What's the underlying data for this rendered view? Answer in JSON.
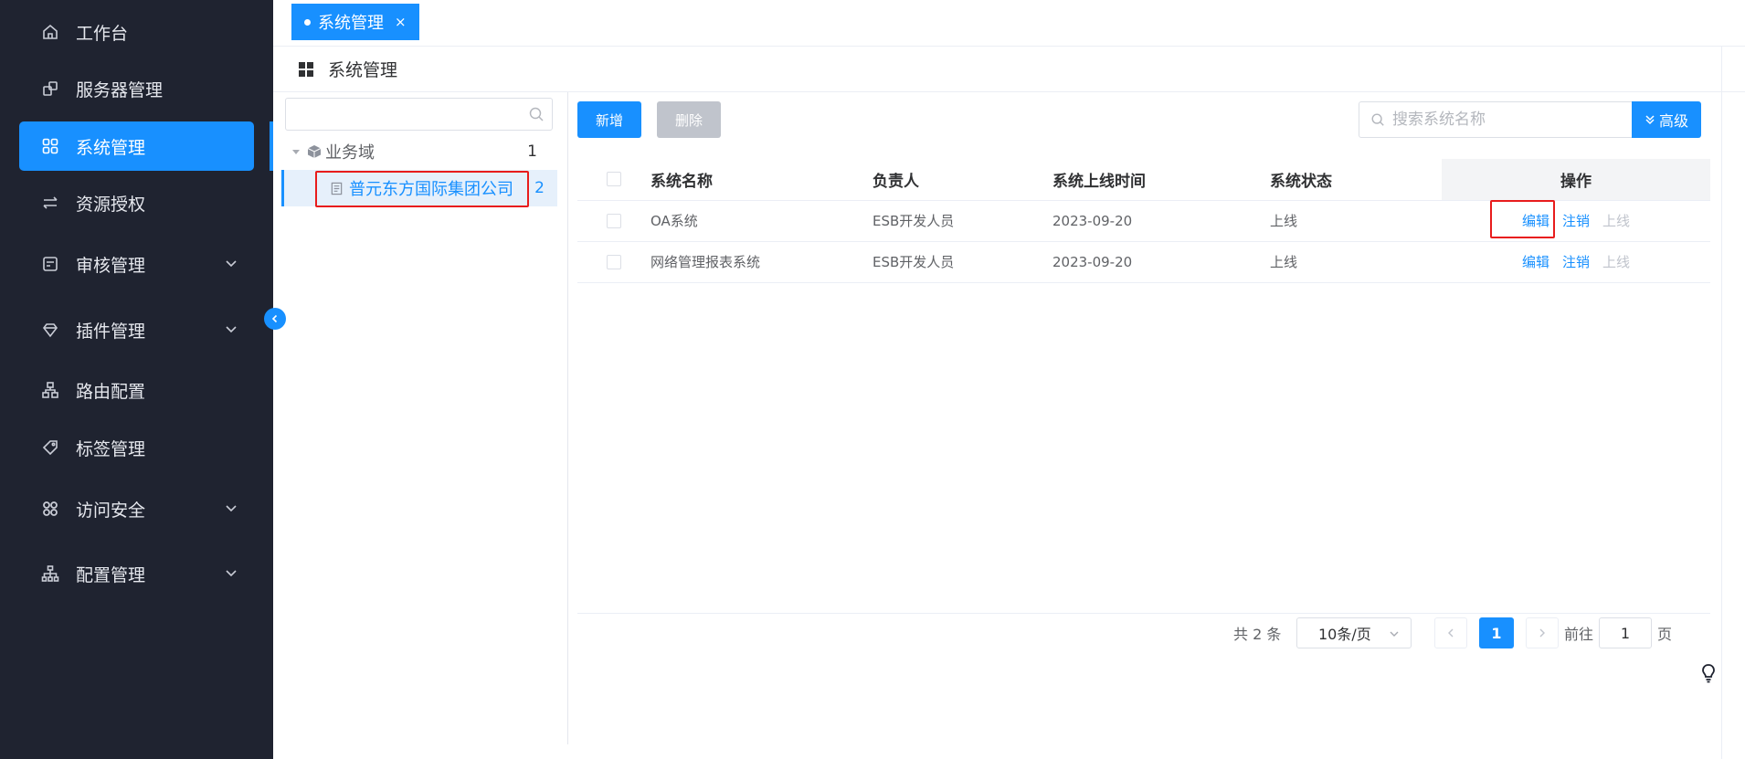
{
  "sidebar": {
    "items": [
      {
        "label": "工作台",
        "icon": "home-icon"
      },
      {
        "label": "服务器管理",
        "icon": "server-icon"
      },
      {
        "label": "系统管理",
        "icon": "grid-icon"
      },
      {
        "label": "资源授权",
        "icon": "transfer-icon"
      },
      {
        "label": "审核管理",
        "icon": "audit-icon"
      },
      {
        "label": "插件管理",
        "icon": "diamond-icon"
      },
      {
        "label": "路由配置",
        "icon": "sitemap-icon"
      },
      {
        "label": "标签管理",
        "icon": "tag-icon"
      },
      {
        "label": "访问安全",
        "icon": "apps-icon"
      },
      {
        "label": "配置管理",
        "icon": "org-icon"
      }
    ]
  },
  "tabs": [
    {
      "label": "系统管理",
      "close": "×"
    }
  ],
  "page": {
    "title": "系统管理"
  },
  "tree": {
    "search_placeholder": "",
    "root": {
      "label": "业务域",
      "count": "1"
    },
    "child": {
      "label": "普元东方国际集团公司",
      "count": "2"
    }
  },
  "toolbar": {
    "add_label": "新增",
    "delete_label": "删除",
    "search_placeholder": "搜索系统名称",
    "advanced_label": "高级"
  },
  "table": {
    "columns": [
      "系统名称",
      "负责人",
      "系统上线时间",
      "系统状态",
      "操作"
    ],
    "rows": [
      {
        "name": "OA系统",
        "owner": "ESB开发人员",
        "date": "2023-09-20",
        "status": "上线",
        "ops": [
          "编辑",
          "注销",
          "上线"
        ]
      },
      {
        "name": "网络管理报表系统",
        "owner": "ESB开发人员",
        "date": "2023-09-20",
        "status": "上线",
        "ops": [
          "编辑",
          "注销",
          "上线"
        ]
      }
    ]
  },
  "pagination": {
    "total": "共 2 条",
    "page_size": "10条/页",
    "current": "1",
    "goto_prefix": "前往",
    "goto_value": "1",
    "goto_suffix": "页"
  },
  "colors": {
    "sidebar_bg": "#1f2330",
    "accent": "#1890ff",
    "highlight": "#e81c1c"
  }
}
